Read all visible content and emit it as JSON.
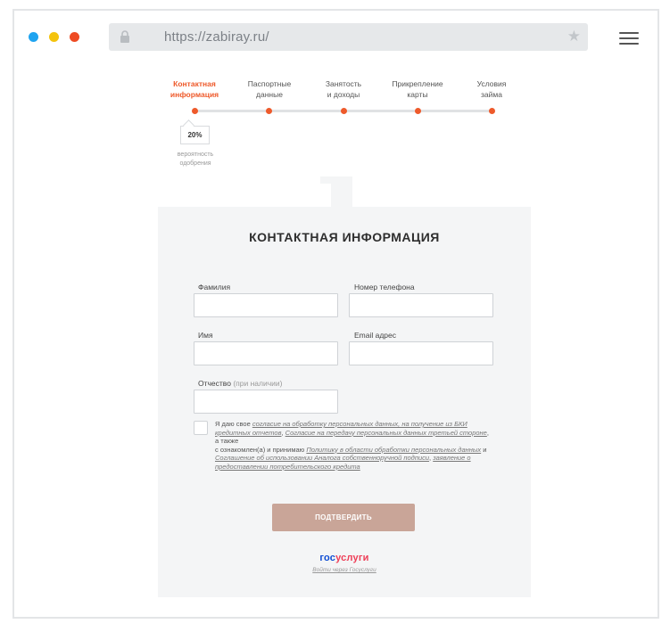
{
  "browser": {
    "url": "https://zabiray.ru/",
    "icons": {
      "lock": "lock-icon",
      "star": "star-icon",
      "menu": "hamburger-menu-icon"
    }
  },
  "steps": {
    "items": [
      {
        "label_line1": "Контактная",
        "label_line2": "информация",
        "active": true
      },
      {
        "label_line1": "Паспортные",
        "label_line2": "данные",
        "active": false
      },
      {
        "label_line1": "Занятость",
        "label_line2": "и доходы",
        "active": false
      },
      {
        "label_line1": "Прикрепление",
        "label_line2": "карты",
        "active": false
      },
      {
        "label_line1": "Условия",
        "label_line2": "займа",
        "active": false
      }
    ],
    "approval_percent": "20%",
    "approval_caption_line1": "вероятность",
    "approval_caption_line2": "одобрения"
  },
  "form": {
    "title": "КОНТАКТНАЯ ИНФОРМАЦИЯ",
    "fields": {
      "last_name": {
        "label": "Фамилия",
        "value": ""
      },
      "phone": {
        "label": "Номер телефона",
        "value": ""
      },
      "first_name": {
        "label": "Имя",
        "value": ""
      },
      "email": {
        "label": "Email адрес",
        "value": ""
      },
      "patronymic": {
        "label": "Отчество",
        "hint": "(при наличии)",
        "value": ""
      }
    },
    "consent": {
      "t1": "Я даю свое ",
      "l1": "согласие на обработку персональных данных, на получение из БКИ кредитных отчетов",
      "t2": ", ",
      "l2": "Согласие на передачу персональных данных третьей стороне",
      "t3": ", а также",
      "t4": "с ознакомлен(а) и принимаю ",
      "l3": "Политику в области обработки персональных данных",
      "t5": " и ",
      "l4": "Соглашение об использовании Аналога собственноручной подписи",
      "t6": ", ",
      "l5": "заявление о предоставлении потребительского кредита"
    },
    "submit_label": "ПОДТВЕРДИТЬ",
    "gosuslugi": {
      "logo_part1": "гос",
      "logo_part2": "услуги",
      "link": "Войти через Госуслуги"
    }
  },
  "colors": {
    "accent": "#ee5a2b",
    "button": "#c9a598",
    "gos_blue": "#0d4cd3",
    "gos_red": "#ee3f58"
  }
}
